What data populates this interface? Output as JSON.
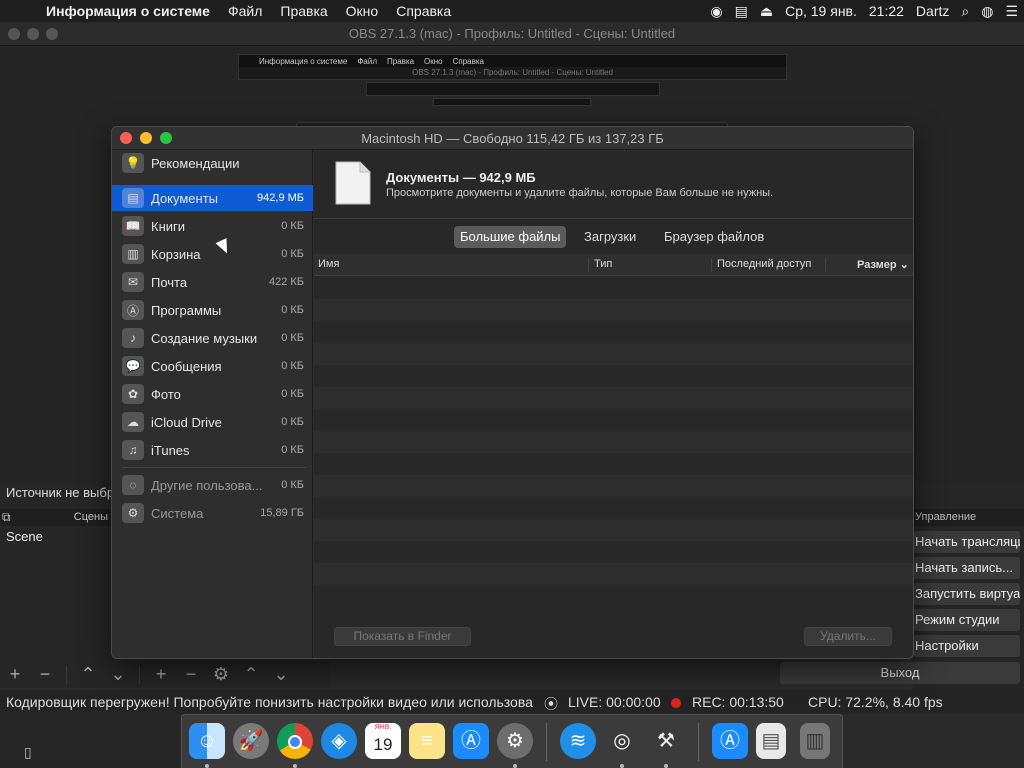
{
  "menubar": {
    "app_name": "Информация о системе",
    "items": [
      "Файл",
      "Правка",
      "Окно",
      "Справка"
    ],
    "date": "Ср, 19 янв.",
    "time": "21:22",
    "user": "Dartz"
  },
  "obs": {
    "title": "OBS 27.1.3 (mac) - Профиль: Untitled - Сцены: Untitled",
    "sources_empty": "Источник не выбран",
    "scenes_header": "Сцены",
    "scene_item": "Scene",
    "controls_header": "Управление",
    "controls": [
      "Начать трансляцию",
      "Начать запись...",
      "Запустить виртуальную камеру",
      "Режим студии",
      "Настройки"
    ],
    "exit": "Выход",
    "status_message": "Кодировщик перегружен! Попробуйте понизить настройки видео или использова",
    "live": "LIVE: 00:00:00",
    "rec": "REC: 00:13:50",
    "cpu": "CPU: 72.2%, 8.40 fps"
  },
  "storage_window": {
    "title": "Macintosh HD — Свободно 115,42 ГБ из 137,23 ГБ",
    "sidebar": [
      {
        "label": "Рекомендации",
        "size": "",
        "icon": "lightbulb-icon",
        "selected": false,
        "dim": false
      },
      {
        "label": "Документы",
        "size": "942,9 МБ",
        "icon": "document-icon",
        "selected": true,
        "dim": false
      },
      {
        "label": "Книги",
        "size": "0 КБ",
        "icon": "book-icon",
        "selected": false,
        "dim": false
      },
      {
        "label": "Корзина",
        "size": "0 КБ",
        "icon": "trash-icon",
        "selected": false,
        "dim": false
      },
      {
        "label": "Почта",
        "size": "422 КБ",
        "icon": "mail-icon",
        "selected": false,
        "dim": false
      },
      {
        "label": "Программы",
        "size": "0 КБ",
        "icon": "apps-icon",
        "selected": false,
        "dim": false
      },
      {
        "label": "Создание музыки",
        "size": "0 КБ",
        "icon": "guitar-icon",
        "selected": false,
        "dim": false
      },
      {
        "label": "Сообщения",
        "size": "0 КБ",
        "icon": "messages-icon",
        "selected": false,
        "dim": false
      },
      {
        "label": "Фото",
        "size": "0 КБ",
        "icon": "photos-icon",
        "selected": false,
        "dim": false
      },
      {
        "label": "iCloud Drive",
        "size": "0 КБ",
        "icon": "cloud-icon",
        "selected": false,
        "dim": false
      },
      {
        "label": "iTunes",
        "size": "0 КБ",
        "icon": "music-icon",
        "selected": false,
        "dim": false
      },
      {
        "label": "Другие пользова...",
        "size": "0 КБ",
        "icon": "users-icon",
        "selected": false,
        "dim": true
      },
      {
        "label": "Система",
        "size": "15,89 ГБ",
        "icon": "gear-icon",
        "selected": false,
        "dim": true
      }
    ],
    "doc_title": "Документы — 942,9 МБ",
    "doc_desc": "Просмотрите документы и удалите файлы, которые Вам больше не нужны.",
    "tabs": [
      "Большие файлы",
      "Загрузки",
      "Браузер файлов"
    ],
    "columns": [
      "Имя",
      "Тип",
      "Последний доступ",
      "Размер ⌄"
    ],
    "show_in_finder": "Показать в Finder",
    "delete": "Удалить..."
  },
  "dock": {
    "apps": [
      "finder-icon",
      "launchpad-icon",
      "chrome-icon",
      "safari-icon",
      "calendar-icon",
      "notes-icon",
      "app-store-icon",
      "system-preferences-icon",
      "wifi-icon",
      "obs-icon",
      "system-info-icon",
      "app-store-icon",
      "file-icon",
      "trash-icon"
    ],
    "calendar_month": "ЯНВ.",
    "calendar_day": "19"
  },
  "colors": {
    "selection": "#0f5bd4",
    "close": "#ff5f57",
    "minimize": "#febc2e",
    "zoom": "#28c840",
    "rec": "#dd2222"
  }
}
